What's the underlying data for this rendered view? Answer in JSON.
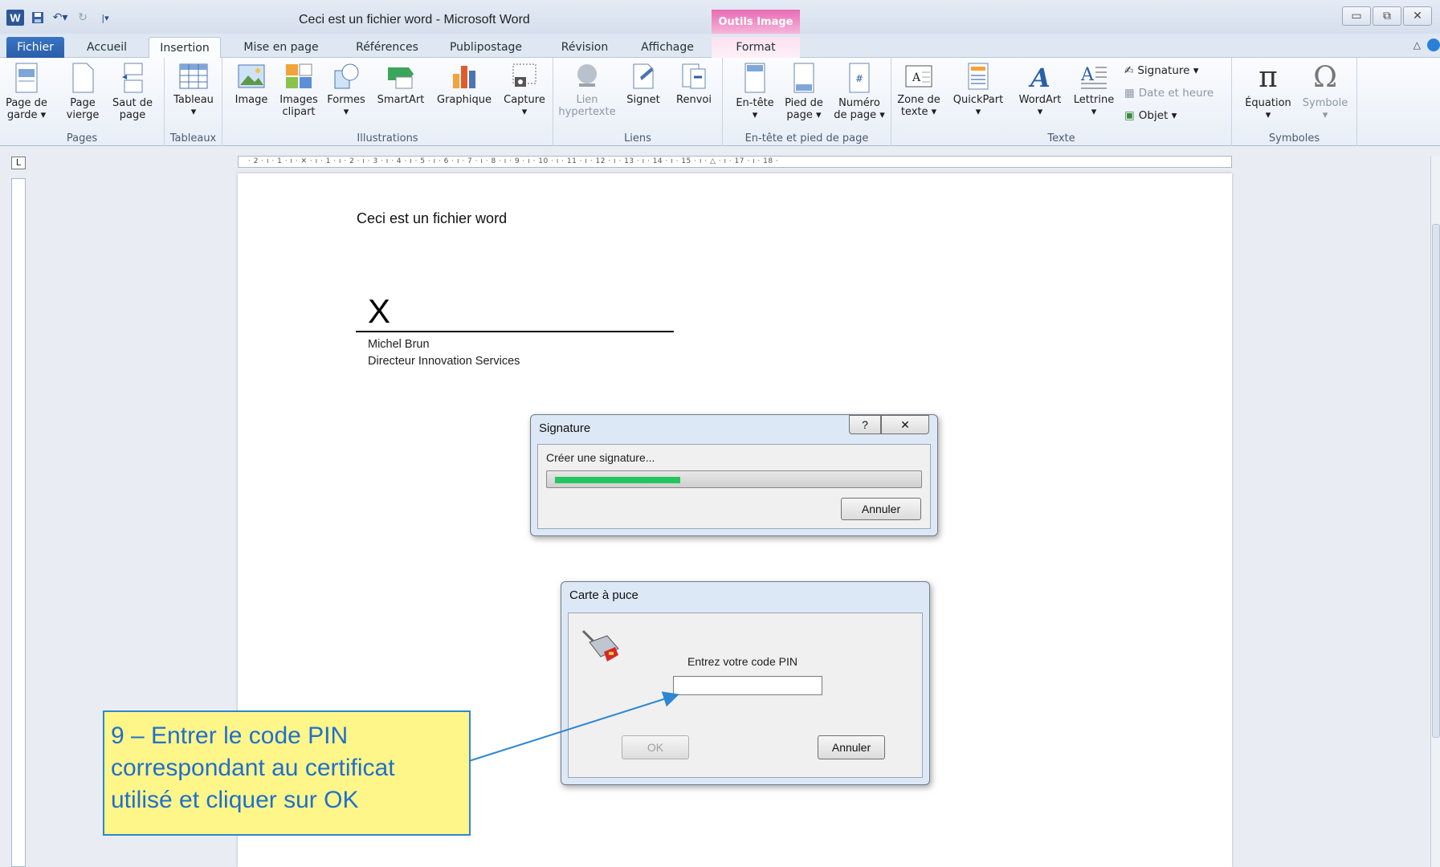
{
  "window": {
    "title": "Ceci est un fichier word  -  Microsoft Word",
    "contextual_group": "Outils Image"
  },
  "tabs": [
    {
      "label": "Fichier"
    },
    {
      "label": "Accueil"
    },
    {
      "label": "Insertion"
    },
    {
      "label": "Mise en page"
    },
    {
      "label": "Références"
    },
    {
      "label": "Publipostage"
    },
    {
      "label": "Révision"
    },
    {
      "label": "Affichage"
    },
    {
      "label": "Format"
    }
  ],
  "ribbon": {
    "groups": {
      "pages": "Pages",
      "tableaux": "Tableaux",
      "illustrations": "Illustrations",
      "liens": "Liens",
      "entete": "En-tête et pied de page",
      "texte": "Texte",
      "symboles": "Symboles"
    },
    "buttons": {
      "page_garde": [
        "Page de",
        "garde ▾"
      ],
      "page_vierge": [
        "Page",
        "vierge"
      ],
      "saut_page": [
        "Saut de",
        "page"
      ],
      "tableau": [
        "Tableau",
        "▾"
      ],
      "image": [
        "Image"
      ],
      "images_clipart": [
        "Images",
        "clipart"
      ],
      "formes": [
        "Formes",
        "▾"
      ],
      "smartart": [
        "SmartArt"
      ],
      "graphique": [
        "Graphique"
      ],
      "capture": [
        "Capture",
        "▾"
      ],
      "lien": [
        "Lien",
        "hypertexte"
      ],
      "signet": [
        "Signet"
      ],
      "renvoi": [
        "Renvoi"
      ],
      "entete": [
        "En-tête",
        "▾"
      ],
      "pied_page": [
        "Pied de",
        "page ▾"
      ],
      "numero_page": [
        "Numéro",
        "de page ▾"
      ],
      "zone_texte": [
        "Zone de",
        "texte ▾"
      ],
      "quickpart": [
        "QuickPart",
        "▾"
      ],
      "wordart": [
        "WordArt",
        "▾"
      ],
      "lettrine": [
        "Lettrine",
        "▾"
      ],
      "signature": "Signature ▾",
      "date_heure": "Date et heure",
      "objet": "Objet ▾",
      "equation": [
        "Équation",
        "▾"
      ],
      "symbole": [
        "Symbole",
        "▾"
      ]
    }
  },
  "ruler": {
    "ticks": "· 2 · ı · 1 · ı ·  ✕  · ı · 1 · ı · 2 · ı · 3 · ı · 4 · ı · 5 · ı · 6 · ı · 7 · ı · 8 · ı · 9 · ı · 10 · ı · 11 · ı · 12 · ı · 13 · ı · 14 · ı · 15 · ı · △ · ı · 17 · ı · 18 ·",
    "corner": "L"
  },
  "document": {
    "text": "Ceci est un fichier word",
    "signature_mark": "X",
    "signer_name": "Michel Brun",
    "signer_title": "Directeur Innovation Services"
  },
  "signature_dialog": {
    "title": "Signature",
    "help": "?",
    "close": "✕",
    "status": "Créer une signature...",
    "progress": 0.35,
    "cancel": "Annuler"
  },
  "smartcard_dialog": {
    "title": "Carte à puce",
    "prompt": "Entrez votre code PIN",
    "pin_value": "",
    "ok": "OK",
    "cancel": "Annuler"
  },
  "callout": {
    "line1": "9 – Entrer le code PIN",
    "line2": "correspondant au certificat",
    "line3": "utilisé et cliquer sur OK"
  },
  "colors": {
    "progress_fill": "#22c55e",
    "callout_bg": "#fff68a",
    "callout_text": "#1f6fd0",
    "contextual_tab": "#e86bb2"
  }
}
